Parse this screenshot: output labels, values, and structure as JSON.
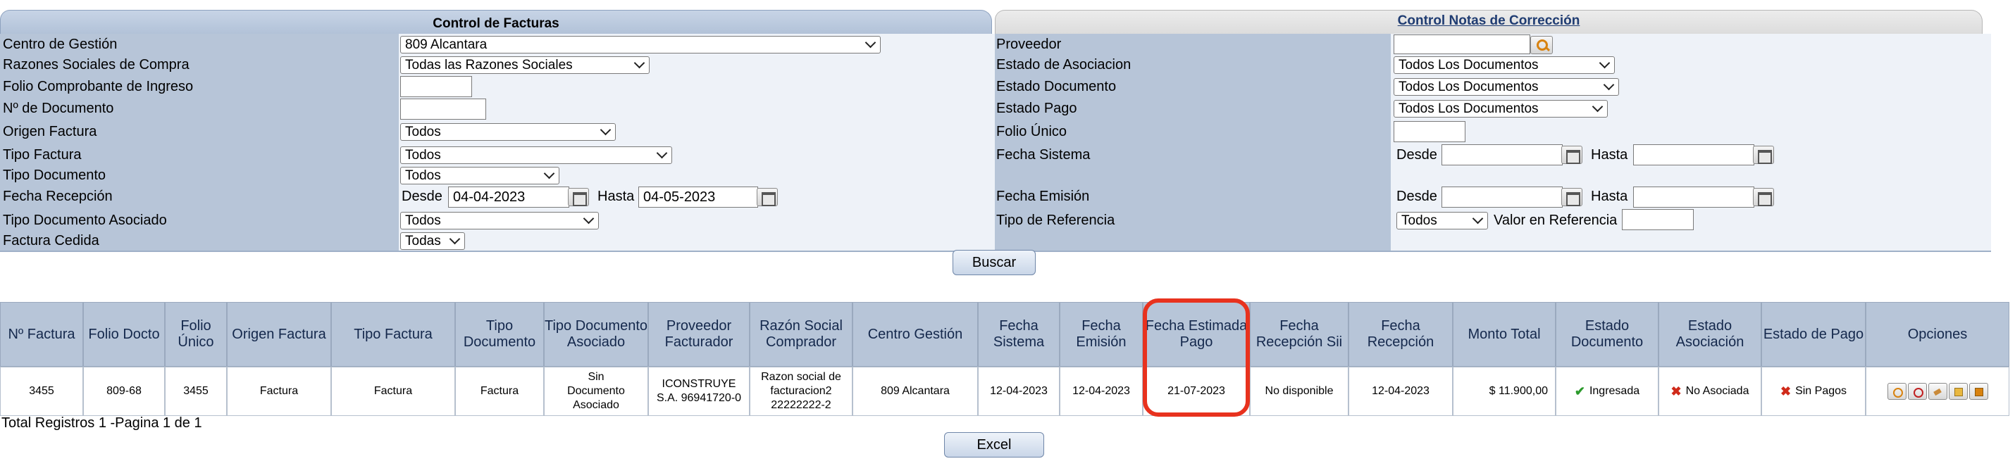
{
  "tabs": {
    "left_title": "Control de Facturas",
    "right_title": "Control Notas de Corrección"
  },
  "left_form": {
    "centro_gestion": {
      "label": "Centro de Gestión",
      "value": "809 Alcantara"
    },
    "razones_sociales": {
      "label": "Razones Sociales de Compra",
      "value": "Todas las Razones Sociales"
    },
    "folio_comprobante": {
      "label": "Folio Comprobante de Ingreso",
      "value": ""
    },
    "num_documento": {
      "label": "Nº de Documento",
      "value": ""
    },
    "origen_factura": {
      "label": "Origen Factura",
      "value": "Todos"
    },
    "tipo_factura": {
      "label": "Tipo Factura",
      "value": "Todos"
    },
    "tipo_documento": {
      "label": "Tipo Documento",
      "value": "Todos"
    },
    "fecha_recepcion": {
      "label": "Fecha Recepción",
      "desde_label": "Desde",
      "desde": "04-04-2023",
      "hasta_label": "Hasta",
      "hasta": "04-05-2023"
    },
    "tipo_doc_asociado": {
      "label": "Tipo Documento Asociado",
      "value": "Todos"
    },
    "factura_cedida": {
      "label": "Factura Cedida",
      "value": "Todas"
    }
  },
  "right_form": {
    "proveedor": {
      "label": "Proveedor",
      "value": ""
    },
    "estado_asociacion": {
      "label": "Estado de Asociacion",
      "value": "Todos Los Documentos"
    },
    "estado_documento": {
      "label": "Estado Documento",
      "value": "Todos Los Documentos"
    },
    "estado_pago": {
      "label": "Estado Pago",
      "value": "Todos Los Documentos"
    },
    "folio_unico": {
      "label": "Folio Único",
      "value": ""
    },
    "fecha_sistema": {
      "label": "Fecha Sistema",
      "desde_label": "Desde",
      "hasta_label": "Hasta"
    },
    "fecha_emision": {
      "label": "Fecha Emisión",
      "desde_label": "Desde",
      "hasta_label": "Hasta"
    },
    "tipo_referencia": {
      "label": "Tipo de Referencia",
      "value": "Todos",
      "valor_label": "Valor en Referencia"
    }
  },
  "buttons": {
    "buscar": "Buscar",
    "excel": "Excel"
  },
  "table": {
    "headers": {
      "n_factura": "Nº Factura",
      "folio_docto": "Folio Docto",
      "folio_unico": "Folio Único",
      "origen_factura": "Origen Factura",
      "tipo_factura": "Tipo Factura",
      "tipo_documento": "Tipo Documento",
      "tipo_doc_asociado": "Tipo Documento Asociado",
      "proveedor": "Proveedor Facturador",
      "razon_social": "Razón Social Comprador",
      "centro_gestion": "Centro Gestión",
      "fecha_sistema": "Fecha Sistema",
      "fecha_emision": "Fecha Emisión",
      "fecha_estimada_pago": "Fecha Estimada Pago",
      "fecha_recepcion_sii": "Fecha Recepción Sii",
      "fecha_recepcion": "Fecha Recepción",
      "monto_total": "Monto Total",
      "estado_documento": "Estado Documento",
      "estado_asociacion": "Estado Asociación",
      "estado_pago": "Estado de Pago",
      "opciones": "Opciones"
    },
    "row": {
      "n_factura": "3455",
      "folio_docto": "809-68",
      "folio_unico": "3455",
      "origen_factura": "Factura",
      "tipo_factura": "Factura",
      "tipo_documento": "Factura",
      "tipo_doc_asociado": "Sin Documento Asociado",
      "proveedor": "ICONSTRUYE S.A. 96941720-0",
      "razon_social": "Razon social de facturacion2 22222222-2",
      "centro_gestion": "809 Alcantara",
      "fecha_sistema": "12-04-2023",
      "fecha_emision": "12-04-2023",
      "fecha_estimada_pago": "21-07-2023",
      "fecha_recepcion_sii": "No disponible",
      "fecha_recepcion": "12-04-2023",
      "monto_total": "$ 11.900,00",
      "estado_documento": "Ingresada",
      "estado_asociacion": "No Asociada",
      "estado_pago": "Sin Pagos"
    }
  },
  "footer": {
    "total_registros": "Total Registros 1 -Pagina 1 de 1"
  },
  "colors": {
    "highlight": "#e8321e",
    "header_bg": "#b7c5d8",
    "panel_bg": "#eef2f8"
  }
}
